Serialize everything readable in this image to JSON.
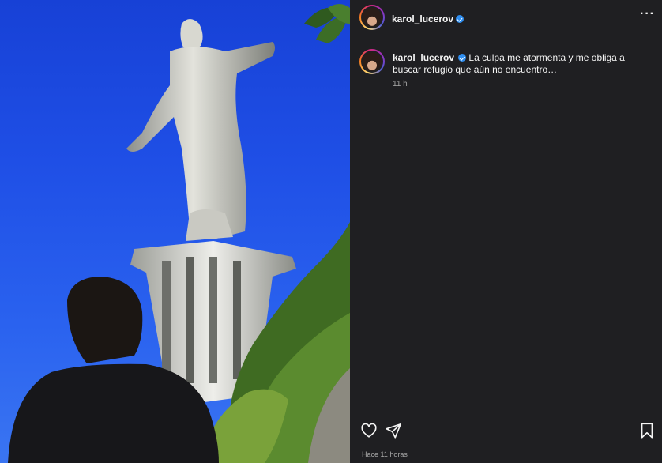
{
  "post": {
    "username": "karol_lucerov",
    "caption": "La culpa me atormenta y me obliga a buscar refugio que aún no encuentro…",
    "time_short": "11 h",
    "posted_ago": "Hace 11 horas"
  },
  "icons": {
    "more": "more-options-icon",
    "like": "heart-icon",
    "share": "paper-plane-icon",
    "save": "bookmark-icon",
    "verified": "verified-badge-icon"
  },
  "colors": {
    "panel": "#1f1f22",
    "verified": "#2f8ef0",
    "muted": "#a8a8a8",
    "sky": "#1f4fe6"
  }
}
